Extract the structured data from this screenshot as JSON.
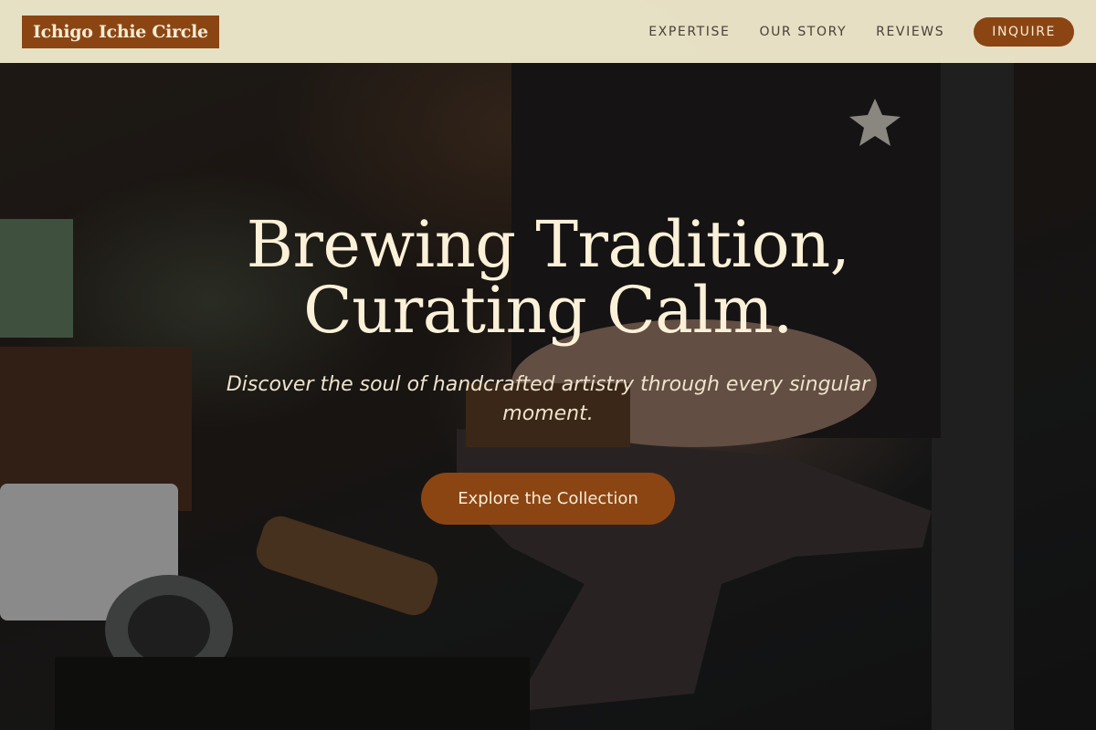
{
  "brand": {
    "name": "Ichigo Ichie Circle"
  },
  "nav": {
    "items": [
      {
        "label": "EXPERTISE"
      },
      {
        "label": "OUR STORY"
      },
      {
        "label": "REVIEWS"
      }
    ],
    "cta_label": "INQUIRE"
  },
  "hero": {
    "title_line1": "Brewing Tradition,",
    "title_line2": "Curating Calm.",
    "subtitle": "Discover the soul of handcrafted artistry through every singular moment.",
    "cta_label": "Explore the Collection",
    "image_icon": "artisan-workbench-photo"
  },
  "colors": {
    "accent": "#8b4513",
    "header_bg": "#eee8cc",
    "title_text": "#fbf1d8",
    "nav_text": "#4a3f36"
  }
}
